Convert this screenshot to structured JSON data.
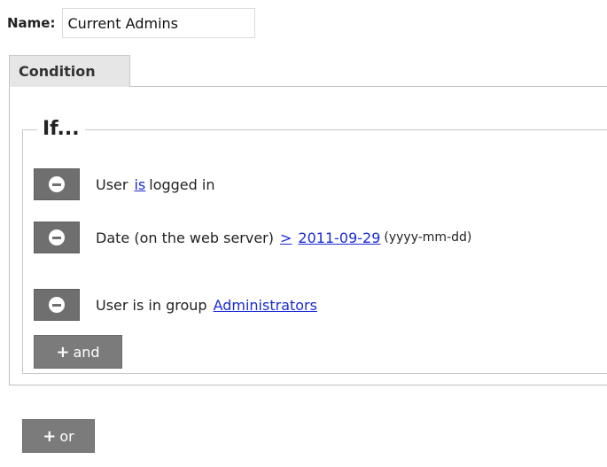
{
  "name": {
    "label": "Name:",
    "value": "Current Admins"
  },
  "tabs": [
    {
      "label": "Condition"
    }
  ],
  "fieldset": {
    "legend": "If..."
  },
  "conditions": [
    {
      "pre": "User",
      "link": "is",
      "post": "logged in"
    },
    {
      "pre": "Date (on the web server)",
      "op_link": ">",
      "value_link": "2011-09-29",
      "hint": "(yyyy-mm-dd)"
    },
    {
      "pre": "User is in group",
      "link": "Administrators"
    }
  ],
  "buttons": {
    "and_label": "and",
    "or_label": "or",
    "plus_symbol": "+"
  },
  "colors": {
    "button_gray": "#6f6f6f",
    "link_blue": "#1a2bd6",
    "tab_bg": "#e6e6e6"
  }
}
